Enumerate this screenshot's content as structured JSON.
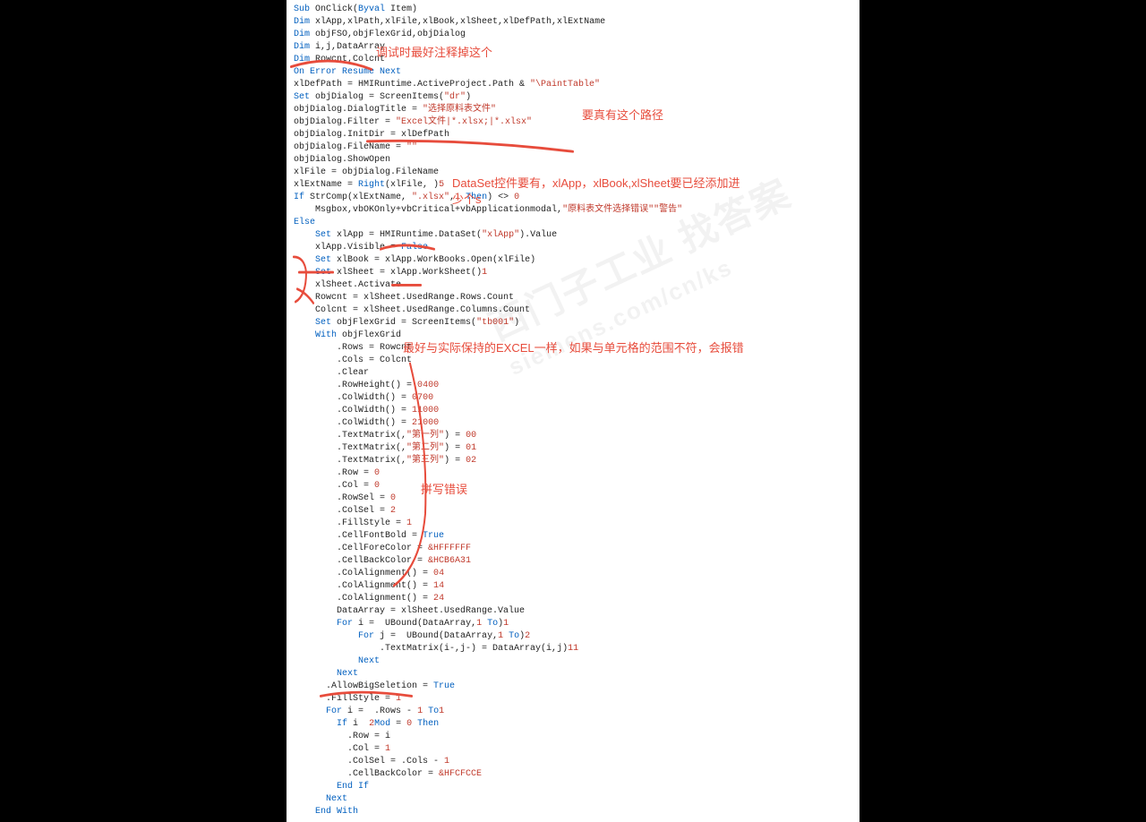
{
  "code": [
    {
      "cls": "kw",
      "t": "Sub",
      "a": " OnClick(",
      "cls2": "kw",
      "t2": "Byval",
      "a2": " Item)"
    },
    {
      "cls": "kw",
      "t": "Dim",
      "a": " xlApp,xlPath,xlFile,xlBook,xlSheet,xlDefPath,xlExtName"
    },
    {
      "cls": "kw",
      "t": "Dim",
      "a": " objFSO,objFlexGrid,objDialog"
    },
    {
      "cls": "kw",
      "t": "Dim",
      "a": " i,j,DataArray"
    },
    {
      "cls": "kw",
      "t": "Dim",
      "a": " Rowcnt,Colcnt"
    },
    {
      "cls": "txt",
      "t": ""
    },
    {
      "cls": "kw",
      "t": "On Error Resume Next"
    },
    {
      "cls": "txt",
      "t": ""
    },
    {
      "cls": "txt",
      "t": "xlDefPath = HMIRuntime.ActiveProject.Path & ",
      "s": "\"\\PaintTable\""
    },
    {
      "cls": "txt",
      "t": ""
    },
    {
      "cls": "kw",
      "t": "Set",
      "a": " objDialog = ScreenItems(",
      "s": "\"dr\"",
      "a2": ")"
    },
    {
      "cls": "txt",
      "t": "objDialog.DialogTitle = ",
      "s": "\"选择原料表文件\""
    },
    {
      "cls": "txt",
      "t": "objDialog.Filter = ",
      "s": "\"Excel文件|*.xlsx;|*.xlsx\""
    },
    {
      "cls": "txt",
      "t": "objDialog.InitDir = xlDefPath"
    },
    {
      "cls": "txt",
      "t": "objDialog.FileName = ",
      "s": "\"\""
    },
    {
      "cls": "txt",
      "t": "objDialog.ShowOpen"
    },
    {
      "cls": "txt",
      "t": ""
    },
    {
      "cls": "txt",
      "t": "xlFile = objDialog.FileName"
    },
    {
      "cls": "txt",
      "t": "xlExtName = ",
      "k": "Right",
      "a": "(xlFile, ",
      "n": "5",
      "a2": ")"
    },
    {
      "cls": "txt",
      "t": ""
    },
    {
      "cls": "kw",
      "t": "If",
      "a": " StrComp(xlExtName, ",
      "s": "\".xlsx\"",
      "a2": ",",
      "n": "1",
      "a3": ") <> ",
      "n2": "0",
      "k2": " Then"
    },
    {
      "cls": "txt",
      "t": "    Msgbox",
      "s": "\"原料表文件选择错误\"",
      "a": ",vbOKOnly+vbCritical+vbApplicationmodal,",
      "s2": "\"警告\""
    },
    {
      "cls": "kw",
      "t": "Else"
    },
    {
      "cls": "txt",
      "t": "    ",
      "k": "Set",
      "a": " xlApp = HMIRuntime.DataSet(",
      "s": "\"xlApp\"",
      "a2": ").Value"
    },
    {
      "cls": "txt",
      "t": "    xlApp.Visible = ",
      "k": "False"
    },
    {
      "cls": "txt",
      "t": "    ",
      "k": "Set",
      "a": " xlBook = xlApp.WorkBooks.Open(xlFile)"
    },
    {
      "cls": "txt",
      "t": "    ",
      "k": "Set",
      "a": " xlSheet = xlApp.WorkSheet(",
      "n": "1",
      "a2": ")"
    },
    {
      "cls": "txt",
      "t": "    xlSheet.Activate"
    },
    {
      "cls": "txt",
      "t": ""
    },
    {
      "cls": "txt",
      "t": "    Rowcnt = xlSheet.UsedRange.Rows.Count"
    },
    {
      "cls": "txt",
      "t": "    Colcnt = xlSheet.UsedRange.Columns.Count"
    },
    {
      "cls": "txt",
      "t": ""
    },
    {
      "cls": "txt",
      "t": "    ",
      "k": "Set",
      "a": " objFlexGrid = ScreenItems(",
      "s": "\"tb001\"",
      "a2": ")"
    },
    {
      "cls": "txt",
      "t": ""
    },
    {
      "cls": "txt",
      "t": "    ",
      "k": "With",
      "a": " objFlexGrid"
    },
    {
      "cls": "txt",
      "t": "        .Rows = Rowcnt"
    },
    {
      "cls": "txt",
      "t": "        .Cols = Colcnt"
    },
    {
      "cls": "txt",
      "t": "        .Clear"
    },
    {
      "cls": "txt",
      "t": "        .RowHeight(",
      "n": "0",
      "a": ") = ",
      "n2": "400"
    },
    {
      "cls": "txt",
      "t": "        .ColWidth(",
      "n": "0",
      "a": ") = ",
      "n2": "700"
    },
    {
      "cls": "txt",
      "t": "        .ColWidth(",
      "n": "1",
      "a": ") = ",
      "n2": "1000"
    },
    {
      "cls": "txt",
      "t": "        .ColWidth(",
      "n": "2",
      "a": ") = ",
      "n2": "1000"
    },
    {
      "cls": "txt",
      "t": "        .TextMatrix(",
      "n": "0",
      "a": ",",
      "n2": "0",
      "a2": ") = ",
      "s": "\"第一列\""
    },
    {
      "cls": "txt",
      "t": "        .TextMatrix(",
      "n": "0",
      "a": ",",
      "n2": "1",
      "a2": ") = ",
      "s": "\"第二列\""
    },
    {
      "cls": "txt",
      "t": "        .TextMatrix(",
      "n": "0",
      "a": ",",
      "n2": "2",
      "a2": ") = ",
      "s": "\"第三列\""
    },
    {
      "cls": "txt",
      "t": "        .Row = ",
      "n": "0"
    },
    {
      "cls": "txt",
      "t": "        .Col = ",
      "n": "0"
    },
    {
      "cls": "txt",
      "t": "        .RowSel = ",
      "n": "0"
    },
    {
      "cls": "txt",
      "t": "        .ColSel = ",
      "n": "2"
    },
    {
      "cls": "txt",
      "t": "        .FillStyle = ",
      "n": "1"
    },
    {
      "cls": "txt",
      "t": "        .CellFontBold = ",
      "k": "True"
    },
    {
      "cls": "txt",
      "t": "        .CellForeColor = ",
      "n": "&HFFFFFF"
    },
    {
      "cls": "txt",
      "t": "        .CellBackColor = ",
      "n": "&HCB6A31"
    },
    {
      "cls": "txt",
      "t": "        .ColAlignment(",
      "n": "0",
      "a": ") = ",
      "n2": "4"
    },
    {
      "cls": "txt",
      "t": "        .ColAlignment(",
      "n": "1",
      "a": ") = ",
      "n2": "4"
    },
    {
      "cls": "txt",
      "t": "        .ColAlignment(",
      "n": "2",
      "a": ") = ",
      "n2": "4"
    },
    {
      "cls": "txt",
      "t": ""
    },
    {
      "cls": "txt",
      "t": "        DataArray = xlSheet.UsedRange.Value"
    },
    {
      "cls": "txt",
      "t": ""
    },
    {
      "cls": "txt",
      "t": "        ",
      "k": "For",
      "a": " i = ",
      "n": "1",
      "k2": " To",
      "a2": " UBound(DataArray,",
      "n2": "1",
      "a3": ")"
    },
    {
      "cls": "txt",
      "t": "            ",
      "k": "For",
      "a": " j = ",
      "n": "1",
      "k2": " To",
      "a2": " UBound(DataArray,",
      "n2": "2",
      "a3": ")"
    },
    {
      "cls": "txt",
      "t": "                .TextMatrix(i-",
      "n": "1",
      "a": ",j-",
      "n2": "1",
      "a2": ") = DataArray(i,j)"
    },
    {
      "cls": "txt",
      "t": "            ",
      "k": "Next"
    },
    {
      "cls": "txt",
      "t": "        ",
      "k": "Next"
    },
    {
      "cls": "txt",
      "t": ""
    },
    {
      "cls": "txt",
      "t": "      .AllowBigSeletion = ",
      "k": "True"
    },
    {
      "cls": "txt",
      "t": "      .FillStyle = ",
      "n": "1"
    },
    {
      "cls": "txt",
      "t": "      ",
      "k": "For",
      "a": " i = ",
      "n": "1",
      "k2": " To",
      "a2": " .Rows - ",
      "n2": "1"
    },
    {
      "cls": "txt",
      "t": "        ",
      "k": "If",
      "a": " i ",
      "k2": "Mod",
      "a2": " ",
      "n": "2",
      "a3": " = ",
      "n2": "0",
      "k3": " Then"
    },
    {
      "cls": "txt",
      "t": "          .Row = i"
    },
    {
      "cls": "txt",
      "t": "          .Col = ",
      "n": "1"
    },
    {
      "cls": "txt",
      "t": "          .ColSel = .Cols - ",
      "n": "1"
    },
    {
      "cls": "txt",
      "t": "          .CellBackColor = ",
      "n": "&HFCFCCE"
    },
    {
      "cls": "txt",
      "t": "        ",
      "k": "End If"
    },
    {
      "cls": "txt",
      "t": "      ",
      "k": "Next"
    },
    {
      "cls": "txt",
      "t": "    ",
      "k": "End With"
    }
  ],
  "annotations": {
    "a1": "调试时最好注释掉这个",
    "a2": "要真有这个路径",
    "a3": "DataSet控件要有，xlApp，xlBook,xlSheet要已经添加进",
    "a3b": "少个s",
    "a4": "最好与实际保持的EXCEL一样，如果与单元格的范围不符，会报错",
    "a5": "拼写错误"
  },
  "watermark": {
    "line1": "西门子工业 找答案",
    "line2": "siemens.com/cn/ks"
  }
}
